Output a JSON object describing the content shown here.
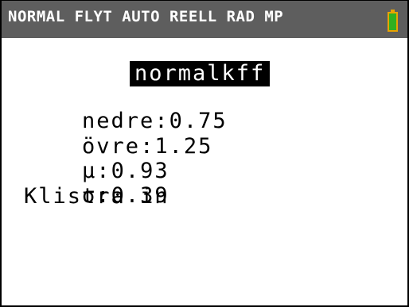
{
  "status_bar": {
    "text": "NORMAL FLYT AUTO REELL RAD MP",
    "battery_icon": "battery-icon",
    "colors": {
      "bar": "#5e5e5e",
      "battery_outline": "#e9a300",
      "battery_fill": "#30b020"
    }
  },
  "menu": {
    "title": "normalkff",
    "params": [
      {
        "label": "nedre",
        "separator": ":",
        "value": "0.75"
      },
      {
        "label": "övre",
        "separator": ":",
        "value": "1.25"
      },
      {
        "label": "μ",
        "separator": ":",
        "value": "0.93"
      },
      {
        "label": "σ",
        "separator": ":",
        "value": "0.39"
      }
    ],
    "paste_label": "Klistra in"
  }
}
